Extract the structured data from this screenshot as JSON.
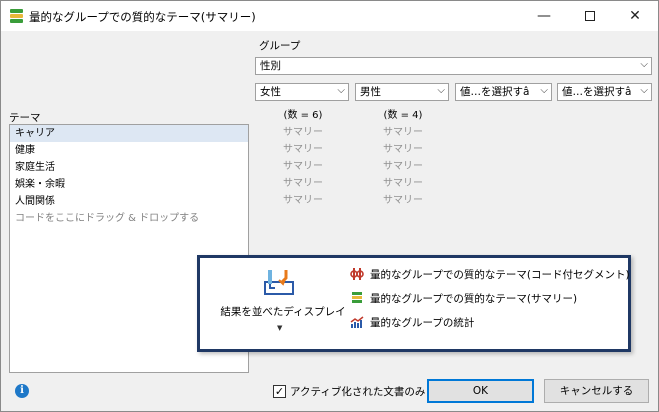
{
  "window": {
    "title": "量的なグループでの質的なテーマ(サマリー)",
    "minimize": "—",
    "close": "✕"
  },
  "group": {
    "label": "グループ",
    "selected": "性別",
    "values": [
      "女性",
      "男性",
      "値…を選択すâ",
      "値…を選択すâ"
    ]
  },
  "theme": {
    "label": "テーマ",
    "items": [
      "キャリア",
      "健康",
      "家庭生活",
      "娯楽・余暇",
      "人間関係"
    ],
    "drop_hint": "コードをここにドラッグ & ドロップする"
  },
  "columns": [
    {
      "count": "(数 = 6)",
      "cells": [
        "サマリー",
        "サマリー",
        "サマリー",
        "サマリー",
        "サマリー"
      ]
    },
    {
      "count": "(数 = 4)",
      "cells": [
        "サマリー",
        "サマリー",
        "サマリー",
        "サマリー",
        "サマリー"
      ]
    }
  ],
  "popup": {
    "display_label": "結果を並べたディスプレイ",
    "options": [
      {
        "label": "量的なグループでの質的なテーマ(コード付セグメント)",
        "icon": "coded-segments-icon"
      },
      {
        "label": "量的なグループでの質的なテーマ(サマリー)",
        "icon": "summary-icon"
      },
      {
        "label": "量的なグループの統計",
        "icon": "statistics-chart-icon"
      }
    ]
  },
  "footer": {
    "checkbox_label": "アクティブ化された文書のみ",
    "checkbox_checked": true,
    "ok": "OK",
    "cancel": "キャンセルする"
  },
  "colors": {
    "accent": "#0078d7",
    "popup_border": "#1f3864",
    "selected_row": "#dde7f3"
  }
}
